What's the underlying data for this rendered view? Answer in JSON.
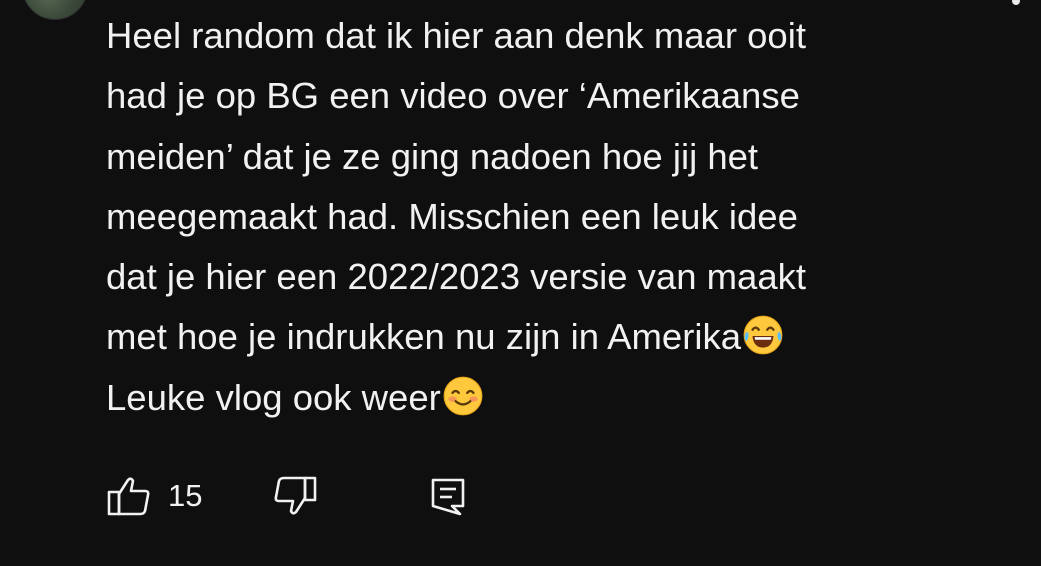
{
  "comment": {
    "lines": [
      "Heel random dat ik hier aan denk maar ooit",
      "had je op BG een video over ‘Amerikaanse",
      "meiden’ dat je ze ging nadoen hoe jij het",
      "meegemaakt had. Misschien een leuk idee",
      "dat je hier een 2022/2023 versie van maakt",
      "met hoe je indrukken nu zijn in Amerika",
      "Leuke vlog ook weer"
    ],
    "emojis": [
      "laughing-tears-emoji",
      "smiling-blush-emoji"
    ]
  },
  "actions": {
    "like_count": "15",
    "icons": [
      "thumbs-up-icon",
      "thumbs-down-icon",
      "reply-icon"
    ]
  },
  "colors": {
    "background": "#0f0f0f",
    "text": "#f1f1f1"
  }
}
